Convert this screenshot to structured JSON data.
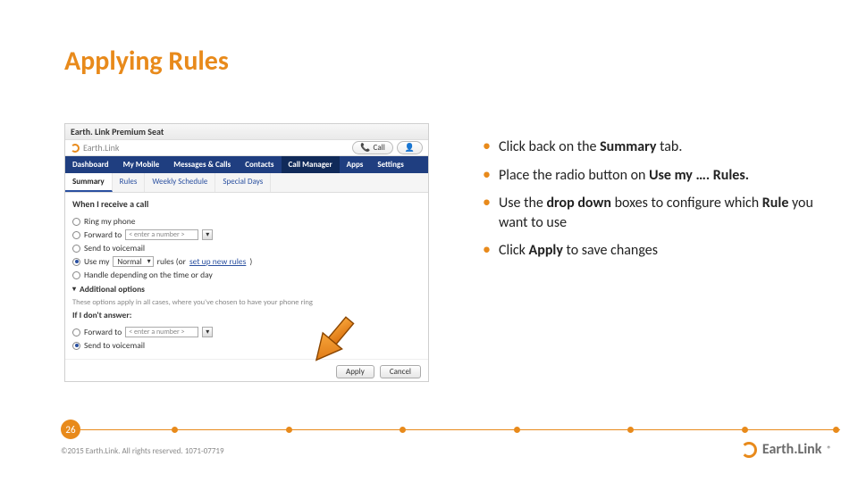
{
  "title": "Applying Rules",
  "bullets": [
    "Click back on the <b>Summary</b> tab.",
    "Place the radio button on <b>Use my …. Rules.</b>",
    "Use the <b>drop down</b> boxes to configure which <b>Rule</b> you want to use",
    "Click <b>Apply</b> to save changes"
  ],
  "mock": {
    "window_title": "Earth. Link Premium Seat",
    "brand": "Earth.Link",
    "top_buttons": {
      "call": "Call",
      "secondary_icon": "user-icon"
    },
    "nav": [
      "Dashboard",
      "My Mobile",
      "Messages & Calls",
      "Contacts",
      "Call Manager",
      "Apps",
      "Settings"
    ],
    "nav_active": "Call Manager",
    "subnav": [
      "Summary",
      "Rules",
      "Weekly Schedule",
      "Special Days"
    ],
    "subnav_active": "Summary",
    "panel": {
      "header": "When I receive a call",
      "options": {
        "ring": "Ring my phone",
        "forward_prefix": "Forward to",
        "forward_placeholder": "< enter a number >",
        "voicemail": "Send to voicemail",
        "use_my_prefix": "Use my",
        "use_my_value": "Normal",
        "use_my_suffix": "rules (or ",
        "use_my_link": "set up new rules",
        "use_my_suffix2": ")",
        "time_of_day": "Handle depending on the time or day"
      },
      "additional": {
        "title": "Additional options",
        "subtitle": "These options apply in all cases, where you've chosen to have your phone ring",
        "if_no_answer": "If I don't answer:",
        "fwd_prefix": "Forward to",
        "fwd_placeholder": "< enter a number >",
        "vm": "Send to voicemail"
      },
      "buttons": {
        "apply": "Apply",
        "cancel": "Cancel"
      }
    }
  },
  "page_number": "26",
  "copyright": "©2015 Earth.Link. All rights reserved. 1071-07719",
  "footer_brand": "Earth.Link"
}
